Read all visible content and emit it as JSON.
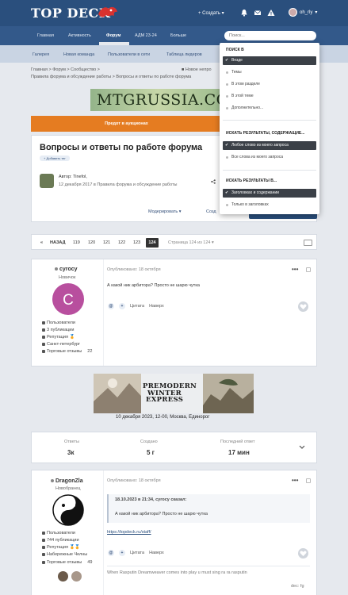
{
  "header": {
    "logo": "TOP DECK",
    "create_label": "Создать",
    "username": "oh_rly"
  },
  "nav": {
    "items": [
      "Главная",
      "Активность",
      "Форум",
      "АДМ 23-24",
      "Больше"
    ],
    "search_placeholder": "Поиск..."
  },
  "subnav": {
    "items": [
      "Галерея",
      "Новая команда",
      "Пользователи в сети",
      "Таблица лидеров"
    ]
  },
  "breadcrumb": {
    "line1": "Главная > Форум > Сообщество >",
    "line2": "Правила форума и обсуждение работы > Вопросы и ответы по работе форума",
    "new_label": "Новое непро"
  },
  "banner_top": {
    "text": "MTGRUSSIA.CO"
  },
  "orange_bar": {
    "text": "Предот в аукционах"
  },
  "topic": {
    "title": "Вопросы и ответы по работе форума",
    "tag_button": "Добавить тег",
    "author": "Автор: Tinefol,",
    "date": "12 декабря 2017 в Правила форума и обсуждение работы"
  },
  "toolbar": {
    "moderate": "Модерировать ▾",
    "create": "Созд"
  },
  "pager": {
    "prev": "«",
    "back": "НАЗАД",
    "pages": [
      "119",
      "120",
      "121",
      "122",
      "123"
    ],
    "current": "124",
    "info": "Страница 124 из 124 ▾"
  },
  "post1": {
    "name": "cyrocy",
    "rank": "Новичок",
    "avatar_letter": "C",
    "avatar_color": "#b84f9e",
    "meta": "Опубликовано: 18 октября",
    "text": "А какой ник арбитора? Просто не шарю чутка",
    "stats": [
      "Пользователи",
      "3 публикации",
      "Репутация 🏅",
      "Санкт-петербург",
      "Торговые отзывы"
    ],
    "trade_count": "22",
    "quote_label": "Цитата",
    "next_label": "Наверх"
  },
  "banner_mid": {
    "line1": "PREMODERN",
    "line2": "WINTER",
    "line3": "EXPRESS",
    "caption": "10 декабря 2023, 12-00, Москва, Единорог"
  },
  "stats": {
    "replies_label": "Ответы",
    "replies": "3к",
    "created_label": "Создано",
    "created": "5 г",
    "last_label": "Последний ответ",
    "last": "17 мин"
  },
  "post2": {
    "name": "DragonZla",
    "rank": "Новобранец",
    "meta": "Опубликовано: 18 октября",
    "quote_header": "18.10.2023 в 21:34, cyrocy сказал:",
    "quote_text": "А какой ник арбитора? Просто не шарю чутка",
    "link": "https://topdeck.ru/staff/",
    "stats": [
      "Пользователи",
      "744 публикации",
      "Репутация 🏅🏅",
      "Набережные Челны",
      "Торговые отзывы"
    ],
    "trade_count": "49",
    "quote_label": "Цитата",
    "next_label": "Наверх",
    "signature": "When Rasputin Dreamweaver comes into play u must sing ra ra rasputin",
    "sig_link": "dec: fg"
  },
  "dropdown": {
    "head1": "ПОИСК В",
    "opts1": [
      "Везде",
      "Темы",
      "В этом разделе",
      "В этой теме",
      "Дополнительно..."
    ],
    "head2": "ИСКАТЬ РЕЗУЛЬТАТЫ, СОДЕРЖАЩИЕ...",
    "opts2": [
      "Любое слово из моего запроса",
      "Все слова из моего запроса"
    ],
    "head3": "ИСКАТЬ РЕЗУЛЬТАТЫ В...",
    "opts3": [
      "Заголовках и содержании",
      "Только в заголовках"
    ]
  }
}
